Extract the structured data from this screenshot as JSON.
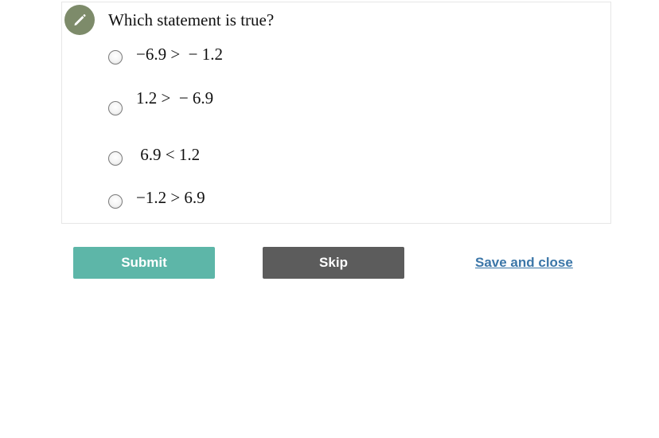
{
  "question": {
    "icon": "pencil-icon",
    "prompt": "Which statement is true?"
  },
  "choices": [
    {
      "label": "−6.9 >  − 1.2"
    },
    {
      "label": "1.2 >  − 6.9"
    },
    {
      "label": " 6.9 < 1.2"
    },
    {
      "label": "−1.2 > 6.9"
    }
  ],
  "actions": {
    "submit_label": "Submit",
    "skip_label": "Skip",
    "save_close_label": "Save and close"
  },
  "colors": {
    "submit": "#5db6a8",
    "skip": "#5c5c5c",
    "link": "#3b76a8",
    "badge": "#7d8b6a"
  }
}
